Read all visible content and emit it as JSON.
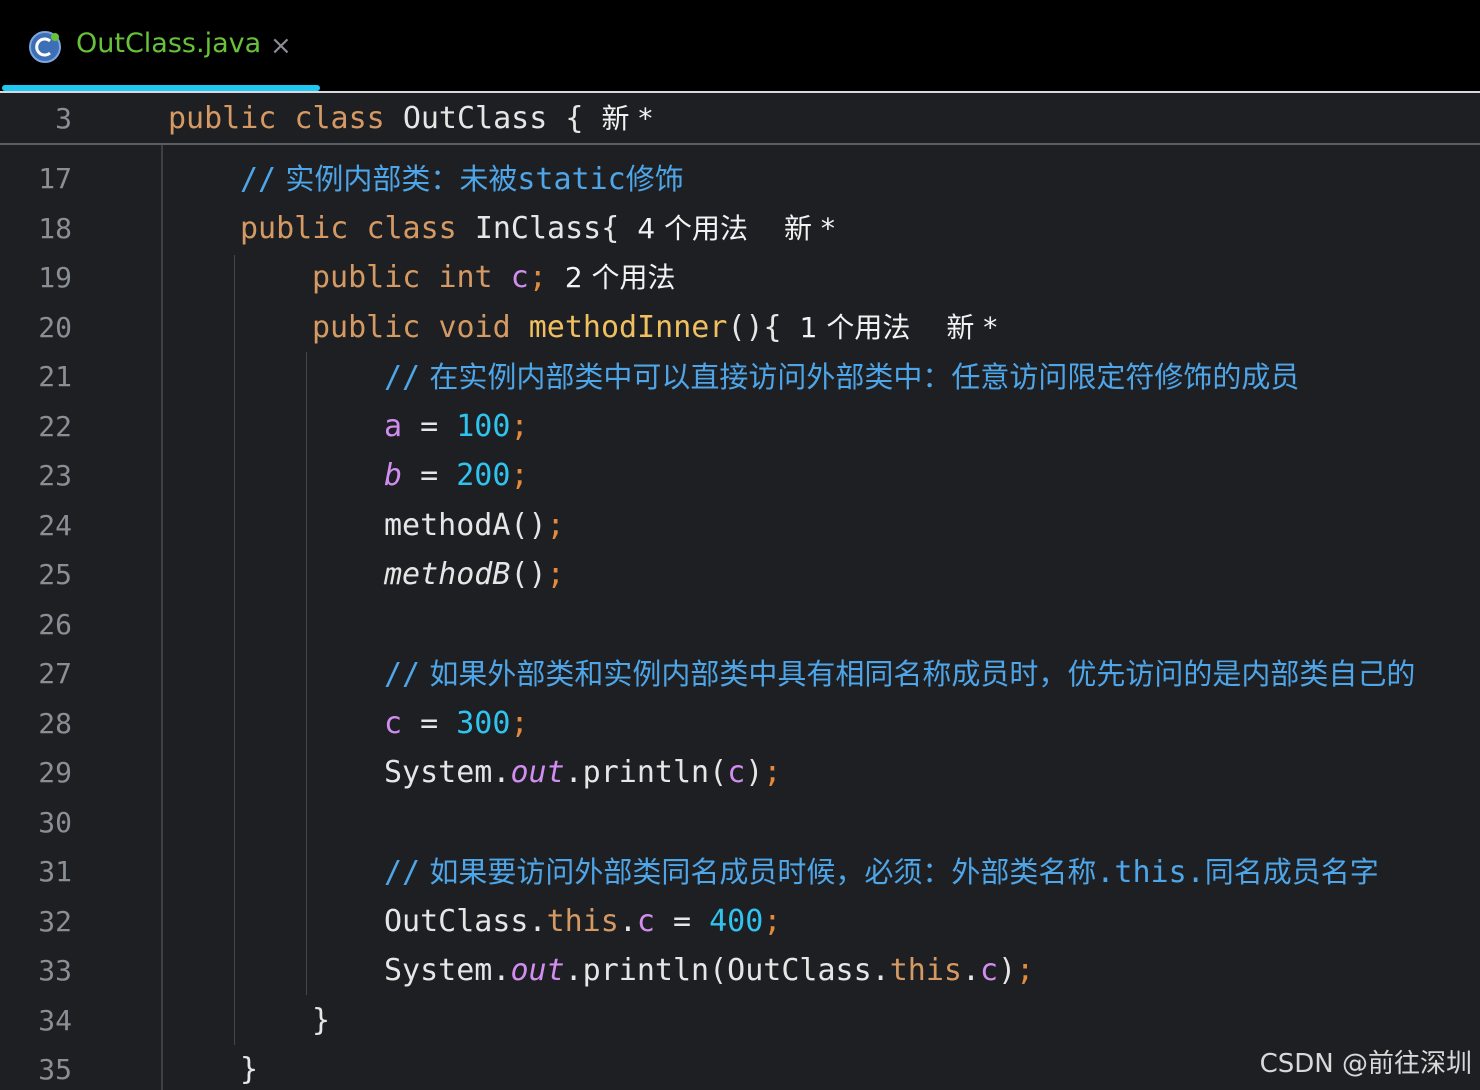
{
  "tab": {
    "filename": "OutClass.java",
    "close_glyph": "×",
    "icon": "java-class-icon"
  },
  "sticky": {
    "line": "3",
    "public": "public",
    "class": "class",
    "name": "OutClass",
    "brace": "{",
    "hint": "新 *"
  },
  "lines": {
    "l17": {
      "no": "17",
      "slashes": "//",
      "text1": " 实例内部类：未被",
      "text2": "static",
      "text3": "修饰"
    },
    "l18": {
      "no": "18",
      "public": "public",
      "class": "class",
      "name": "InClass{",
      "usages": "4 个用法",
      "new": "新 *"
    },
    "l19": {
      "no": "19",
      "public": "public",
      "int": "int",
      "field": "c",
      "semi": ";",
      "usages": "2 个用法"
    },
    "l20": {
      "no": "20",
      "public": "public",
      "void": "void",
      "method": "methodInner",
      "rest": "(){",
      "usages": "1 个用法",
      "new": "新 *"
    },
    "l21": {
      "no": "21",
      "slashes": "//",
      "text": " 在实例内部类中可以直接访问外部类中：任意访问限定符修饰的成员"
    },
    "l22": {
      "no": "22",
      "field": "a",
      "eq": " = ",
      "num": "100",
      "semi": ";"
    },
    "l23": {
      "no": "23",
      "field": "b",
      "eq": " = ",
      "num": "200",
      "semi": ";"
    },
    "l24": {
      "no": "24",
      "call": "methodA()",
      "semi": ";"
    },
    "l25": {
      "no": "25",
      "call": "methodB",
      "paren": "()",
      "semi": ";"
    },
    "l26": {
      "no": "26"
    },
    "l27": {
      "no": "27",
      "slashes": "//",
      "text": " 如果外部类和实例内部类中具有相同名称成员时，优先访问的是内部类自己的"
    },
    "l28": {
      "no": "28",
      "field": "c",
      "eq": " = ",
      "num": "300",
      "semi": ";"
    },
    "l29": {
      "no": "29",
      "sys": "System.",
      "out": "out",
      "rest": ".println(",
      "field": "c",
      "close": ")",
      "semi": ";"
    },
    "l30": {
      "no": "30"
    },
    "l31": {
      "no": "31",
      "slashes": "//",
      "text1": " 如果要访问外部类同名成员时候，必须：外部类名称",
      "text2": ".this.",
      "text3": "同名成员名字"
    },
    "l32": {
      "no": "32",
      "cls": "OutClass.",
      "this": "this",
      "dot": ".",
      "field": "c",
      "eq": " = ",
      "num": "400",
      "semi": ";"
    },
    "l33": {
      "no": "33",
      "sys": "System.",
      "out": "out",
      "rest": ".println(OutClass.",
      "this": "this",
      "dot": ".",
      "field": "c",
      "close": ")",
      "semi": ";"
    },
    "l34": {
      "no": "34",
      "brace": "}"
    },
    "l35": {
      "no": "35",
      "brace": "}"
    }
  },
  "watermark": "CSDN @前往深圳",
  "colors": {
    "keyword": "#d59a63",
    "method_decl": "#f0c060",
    "field": "#d18ef0",
    "number": "#2fc4ef",
    "comment": "#4ea5e8",
    "tab_title": "#67c23a",
    "tab_underline": "#1fc8f3"
  }
}
